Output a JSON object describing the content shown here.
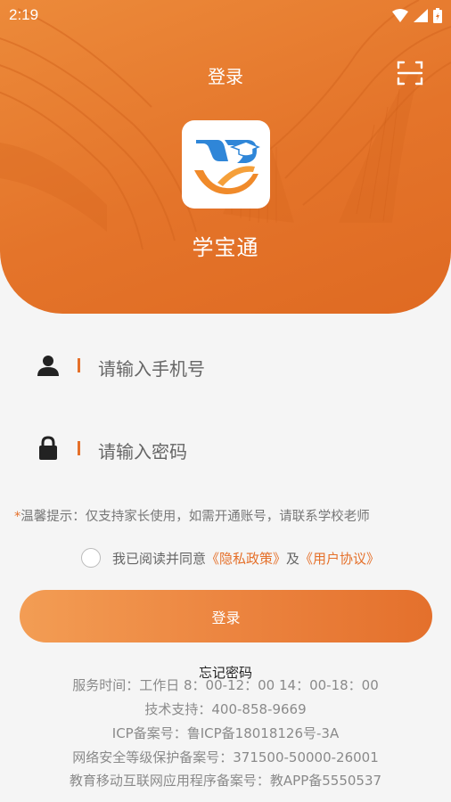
{
  "status_bar": {
    "time": "2:19"
  },
  "header": {
    "title": "登录",
    "scan_icon": "scan-icon"
  },
  "app": {
    "name": "学宝通",
    "logo_icon": "xuebaotong-logo-icon"
  },
  "form": {
    "phone": {
      "icon": "user-icon",
      "placeholder": "请输入手机号"
    },
    "password": {
      "icon": "lock-icon",
      "placeholder": "请输入密码"
    }
  },
  "tip": {
    "star": "*",
    "text": "温馨提示：仅支持家长使用，如需开通账号，请联系学校老师"
  },
  "agreement": {
    "prefix": "我已阅读并同意",
    "privacy": "《隐私政策》",
    "and": "及",
    "terms": "《用户协议》"
  },
  "login_button": "登录",
  "forgot_password": "忘记密码",
  "footer": {
    "service_hours": "服务时间：工作日 8：00-12：00 14：00-18：00",
    "support": "技术支持：400-858-9669",
    "icp": "ICP备案号：鲁ICP备18018126号-3A",
    "security": "网络安全等级保护备案号：371500-50000-26001",
    "edu_app": "教育移动互联网应用程序备案号：教APP备5550537"
  },
  "colors": {
    "accent": "#e5702a",
    "header_start": "#ec8a3a",
    "header_end": "#df6a22",
    "background": "#f5f5f5"
  }
}
